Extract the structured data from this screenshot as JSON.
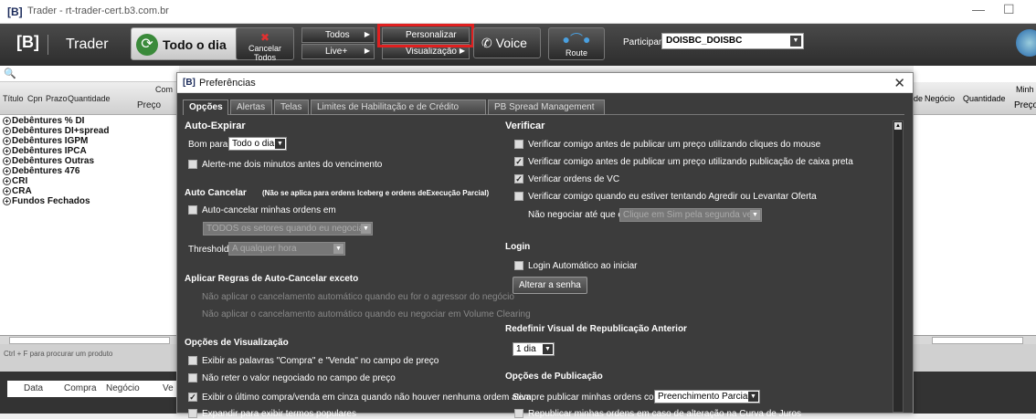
{
  "window": {
    "logo": "[B]",
    "title": "Trader - rt-trader-cert.b3.com.br",
    "min": "—",
    "max": "☐"
  },
  "toolbar": {
    "logo": "[B]",
    "app": "Trader",
    "todo_dia": "Todo o dia",
    "cancelar": "Cancelar Todos",
    "todos": "Todos",
    "live": "Live+",
    "personalizar": "Personalizar",
    "visualizacao": "Visualização",
    "voice": "Voice",
    "route": "Route",
    "participante_label": "Participante:",
    "participante_value": "DOISBC_DOISBC"
  },
  "left": {
    "search": "🔍",
    "cols": [
      "Título",
      "Cpn",
      "Prazo",
      "Quantidade",
      "Com",
      "Preço"
    ],
    "items": [
      "Debêntures % DI",
      "Debêntures DI+spread",
      "Debêntures IGPM",
      "Debêntures IPCA",
      "Debêntures Outras",
      "Debêntures 476",
      "CRI",
      "CRA",
      "Fundos Fechados"
    ],
    "status": "Ctrl + F para procurar um produto",
    "bottom_tabs": [
      "Data",
      "Compra",
      "Negócio",
      "Ve"
    ]
  },
  "right": {
    "cols": [
      "de",
      "Negócio",
      "Quantidade",
      "Minh",
      "Preço"
    ]
  },
  "dialog": {
    "logo": "[B]",
    "title": "Preferências",
    "close": "✕",
    "tabs": [
      "Opções",
      "Alertas",
      "Telas",
      "Limites de Habilitação e de Crédito",
      "PB Spread Management"
    ],
    "auto_expirar": {
      "title": "Auto-Expirar",
      "bom_para": "Bom para:",
      "bom_para_value": "Todo o dia",
      "alerte": "Alerte-me dois minutos antes do vencimento"
    },
    "auto_cancelar": {
      "title": "Auto Cancelar",
      "note": "(Não se aplica para ordens Iceberg e ordens deExecução Parcial)",
      "cb": "Auto-cancelar minhas ordens em",
      "setores": "TODOS os setores quando eu negociar",
      "threshold": "Threshold",
      "threshold_value": "A qualquer hora"
    },
    "aplicar": {
      "title": "Aplicar Regras de Auto-Cancelar exceto",
      "o1": "Não aplicar o cancelamento automático quando eu for o agressor do negócio",
      "o2": "Não aplicar o cancelamento automático quando eu negociar em Volume Clearing"
    },
    "visualizacao": {
      "title": "Opções de Visualização",
      "o1": "Exibir as palavras \"Compra\" e \"Venda\" no campo de preço",
      "o2": "Não reter o valor negociado no campo de preço",
      "o3": "Exibir o último compra/venda em cinza quando não houver nenhuma ordem ativa",
      "o4": "Expandir para exibir termos populares"
    },
    "verificar": {
      "title": "Verificar",
      "o1": "Verificar comigo antes de publicar um preço utilizando cliques do mouse",
      "o2": "Verificar comigo antes de publicar um preço utilizando publicação de caixa preta",
      "o3": "Verificar ordens de VC",
      "o4": "Verificar comigo quando eu estiver tentando Agredir ou Levantar Oferta",
      "nao_negociar": "Não negociar até que eu",
      "nao_negociar_value": "Clique em Sim pela segunda vez"
    },
    "login": {
      "title": "Login",
      "auto": "Login Automático ao iniciar",
      "alterar": "Alterar a senha"
    },
    "redefinir": {
      "title": "Redefinir Visual de Republicação Anterior",
      "value": "1 dia"
    },
    "publicacao": {
      "title": "Opções de Publicação",
      "sempre": "Sempre publicar minhas ordens como",
      "sempre_value": "Preenchimento Parcial",
      "o2": "Republicar minhas ordens em caso de alteração na Curva de Juros"
    }
  }
}
